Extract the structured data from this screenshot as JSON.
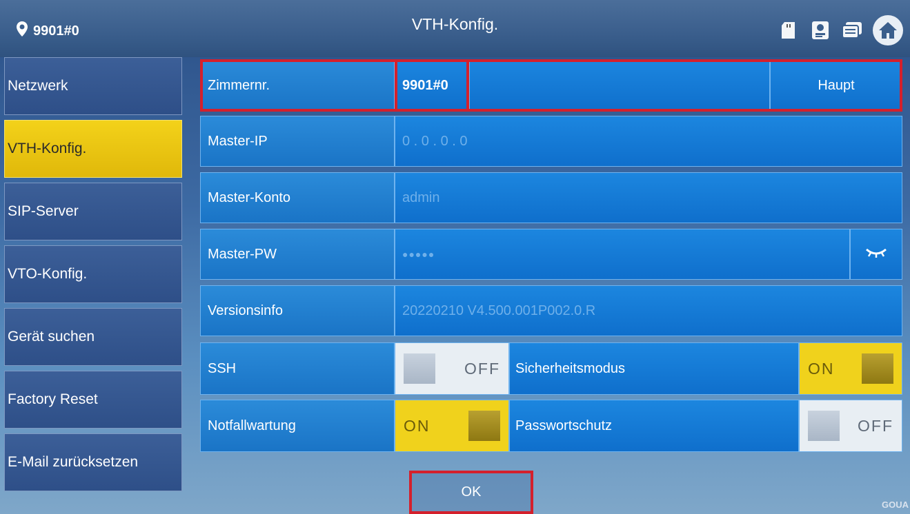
{
  "header": {
    "location": "9901#0",
    "title": "VTH-Konfig."
  },
  "sidebar": {
    "items": [
      {
        "label": "Netzwerk"
      },
      {
        "label": "VTH-Konfig."
      },
      {
        "label": "SIP-Server"
      },
      {
        "label": "VTO-Konfig."
      },
      {
        "label": "Gerät suchen"
      },
      {
        "label": "Factory Reset"
      },
      {
        "label": "E-Mail zurücksetzen"
      }
    ],
    "active_index": 1
  },
  "form": {
    "room": {
      "label": "Zimmernr.",
      "value": "9901#0",
      "mode": "Haupt"
    },
    "master_ip": {
      "label": "Master-IP",
      "value": "0 . 0 . 0 . 0"
    },
    "master_account": {
      "label": "Master-Konto",
      "value": "admin"
    },
    "master_pw": {
      "label": "Master-PW",
      "value": "●●●●●"
    },
    "version": {
      "label": "Versionsinfo",
      "value": "20220210 V4.500.001P002.0.R"
    },
    "ssh": {
      "label": "SSH",
      "state": "OFF"
    },
    "security_mode": {
      "label": "Sicherheitsmodus",
      "state": "ON"
    },
    "emergency": {
      "label": "Notfallwartung",
      "state": "ON"
    },
    "password_protection": {
      "label": "Passwortschutz",
      "state": "OFF"
    }
  },
  "actions": {
    "ok_label": "OK"
  },
  "brand": "GOUA",
  "colors": {
    "accent": "#1a7fd8",
    "active": "#f0d21c",
    "highlight": "#d4202c"
  },
  "icons": [
    "location-pin-icon",
    "sd-card-icon",
    "contact-card-icon",
    "message-icon",
    "home-icon",
    "eye-closed-icon"
  ]
}
